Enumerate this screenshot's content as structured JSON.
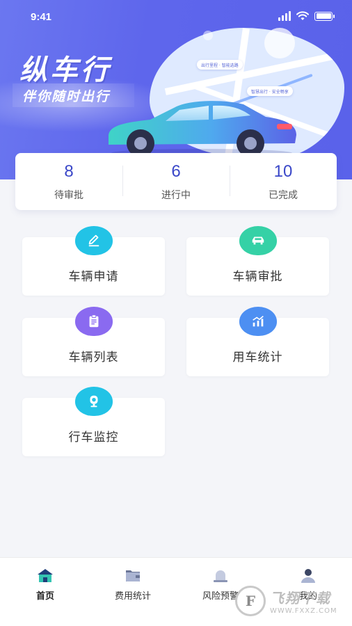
{
  "status_bar": {
    "time": "9:41"
  },
  "banner": {
    "title": "纵车行",
    "subtitle": "伴你随时出行",
    "map_tag_1": "出行里程 · 智能选路",
    "map_tag_2": "智慧出行 · 安全畅享"
  },
  "stats": [
    {
      "value": "8",
      "label": "待审批"
    },
    {
      "value": "6",
      "label": "进行中"
    },
    {
      "value": "10",
      "label": "已完成"
    }
  ],
  "tiles": [
    {
      "label": "车辆申请",
      "icon": "edit-icon",
      "color": "#22c3e6"
    },
    {
      "label": "车辆审批",
      "icon": "car-icon",
      "color": "#35d1a6"
    },
    {
      "label": "车辆列表",
      "icon": "clipboard-icon",
      "color": "#8a6af0"
    },
    {
      "label": "用车统计",
      "icon": "bar-chart-icon",
      "color": "#4d8ff2"
    },
    {
      "label": "行车监控",
      "icon": "camera-icon",
      "color": "#22c3e6"
    }
  ],
  "tabbar": [
    {
      "label": "首页",
      "icon": "home-icon",
      "active": true
    },
    {
      "label": "费用统计",
      "icon": "wallet-icon",
      "active": false
    },
    {
      "label": "风险预警",
      "icon": "alarm-icon",
      "active": false
    },
    {
      "label": "我的",
      "icon": "user-icon",
      "active": false
    }
  ],
  "watermark": {
    "logo": "F",
    "name": "飞翔下载",
    "url": "WWW.FXXZ.COM"
  },
  "colors": {
    "primary": "#5e66ec",
    "stat_value": "#3a47c8",
    "background": "#f4f5f9"
  }
}
